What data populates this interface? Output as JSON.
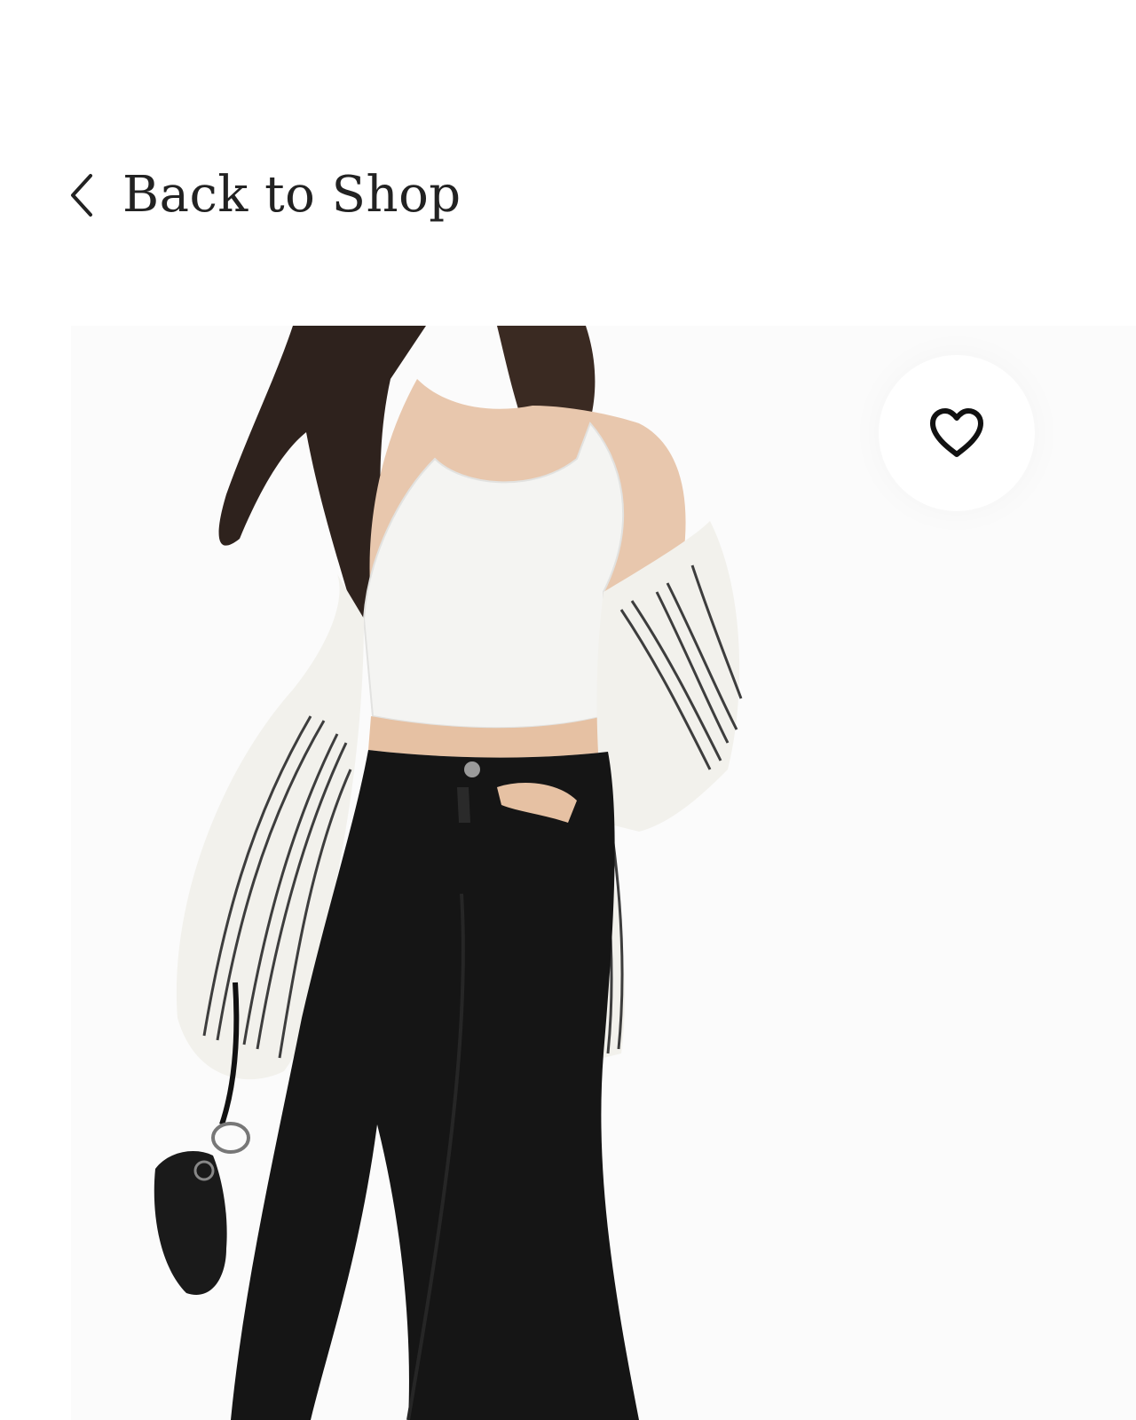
{
  "nav": {
    "back_label": "Back to Shop",
    "back_icon": "chevron-left-icon"
  },
  "product": {
    "wishlist_icon": "heart-outline-icon",
    "image_subject": "photo"
  },
  "colors": {
    "text": "#222222",
    "background": "#ffffff",
    "icon": "#111111"
  }
}
